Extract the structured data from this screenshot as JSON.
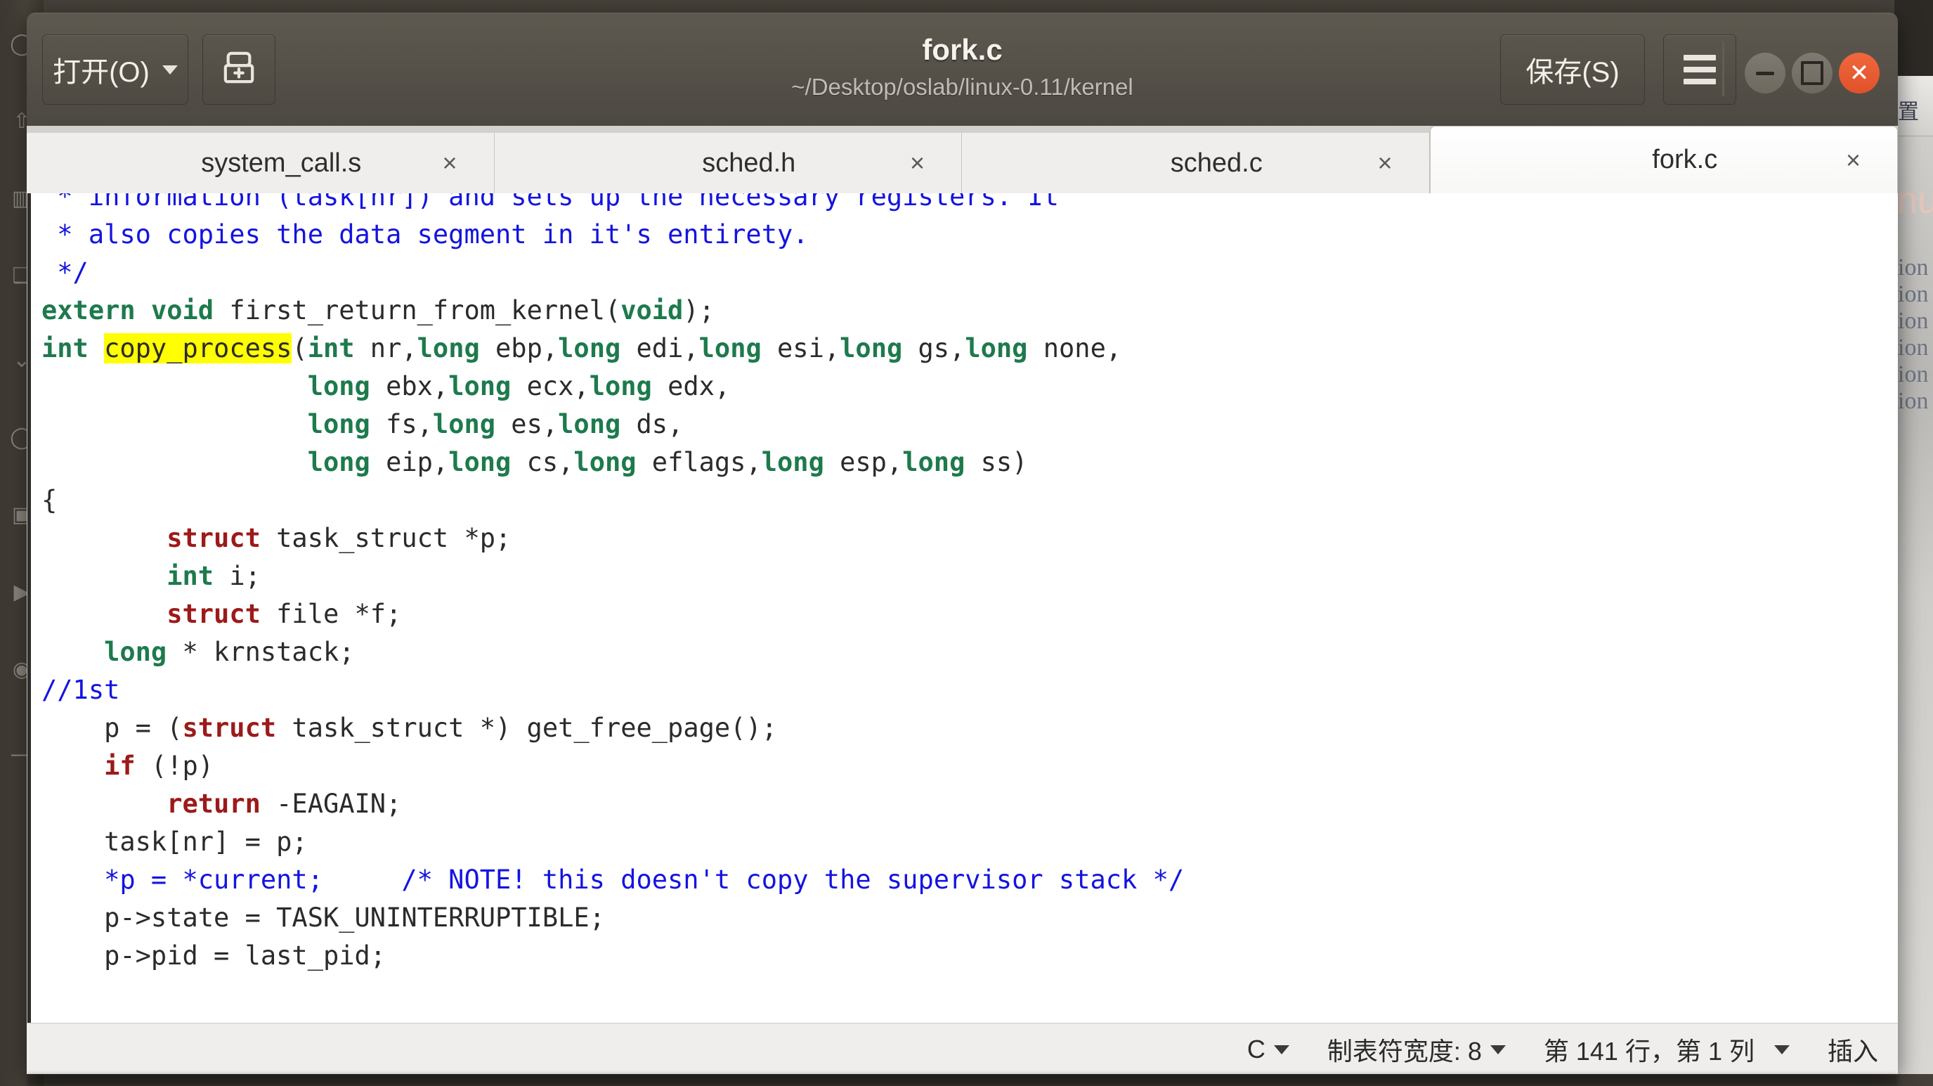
{
  "window": {
    "title": "fork.c",
    "subtitle": "~/Desktop/oslab/linux-0.11/kernel",
    "open_button": "打开(O)",
    "new_tab_icon": "new-document-icon",
    "save_button": "保存(S)",
    "menu_icon": "hamburger-menu-icon",
    "minimize_icon": "minimize-icon",
    "maximize_icon": "maximize-icon",
    "close_icon": "close-icon"
  },
  "tabs": [
    {
      "label": "system_call.s",
      "close": "×",
      "active": false
    },
    {
      "label": "sched.h",
      "close": "×",
      "active": false
    },
    {
      "label": "sched.c",
      "close": "×",
      "active": false
    },
    {
      "label": "fork.c",
      "close": "×",
      "active": true
    }
  ],
  "editor": {
    "highlight_term": "copy_process",
    "lines": [
      " * information (task[nr]) and sets up the necessary registers. It",
      " * also copies the data segment in it's entirety.",
      " */",
      "extern void first_return_from_kernel(void);",
      "int copy_process(int nr,long ebp,long edi,long esi,long gs,long none,",
      "                 long ebx,long ecx,long edx,",
      "                 long fs,long es,long ds,",
      "                 long eip,long cs,long eflags,long esp,long ss)",
      "{",
      "        struct task_struct *p;",
      "        int i;",
      "        struct file *f;",
      "    long * krnstack;",
      "//1st",
      "    p = (struct task_struct *) get_free_page();",
      "    if (!p)",
      "        return -EAGAIN;",
      "    task[nr] = p;",
      "    *p = *current;     /* NOTE! this doesn't copy the supervisor stack */",
      "    p->state = TASK_UNINTERRUPTIBLE;",
      "    p->pid = last_pid;"
    ]
  },
  "statusbar": {
    "language": "C",
    "tab_width": "制表符宽度: 8",
    "cursor_position": "第 141 行，第 1 列",
    "insert_mode": "插入"
  },
  "background": {
    "window_rows": [
      "ion",
      "ion",
      "ion",
      "ion",
      "ion",
      "ion"
    ],
    "window_toolbar": "置",
    "window_logo": "nux"
  },
  "dock": {
    "icons": [
      "circle-icon",
      "arrow-up-icon",
      "folder-icon",
      "book-icon",
      "chevron-icon",
      "circle-icon",
      "camera-icon",
      "play-icon",
      "globe-icon",
      "dash-icon"
    ]
  },
  "colors": {
    "comment": "#1414e0",
    "type_keyword": "#1d7a4c",
    "control_keyword": "#9c1a1a",
    "highlight": "#ffff00",
    "accent_close": "#e0512a"
  }
}
